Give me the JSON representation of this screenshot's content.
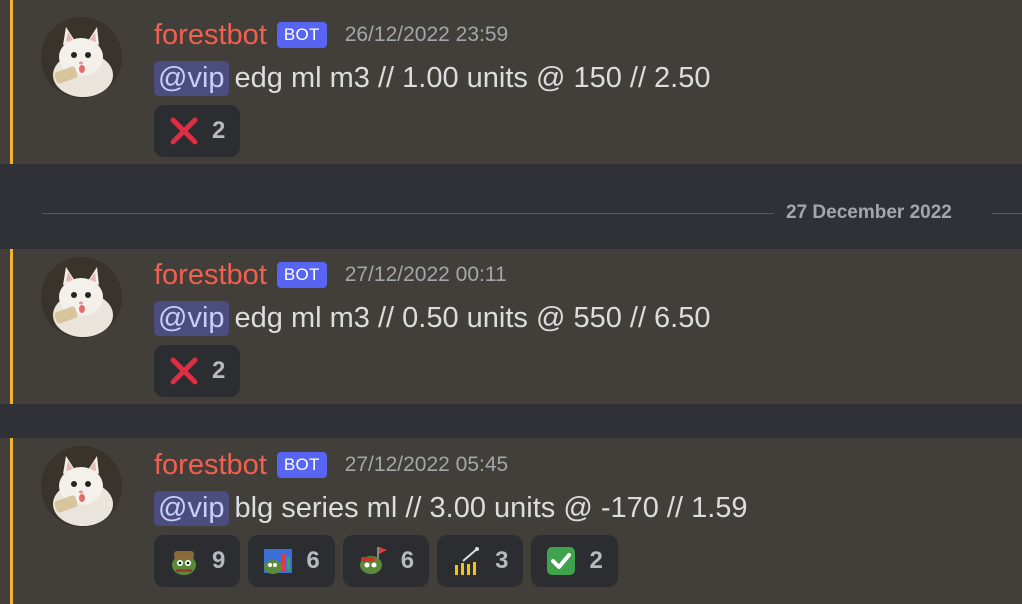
{
  "date_divider": "27 December 2022",
  "messages": [
    {
      "username": "forestbot",
      "bot_tag": "BOT",
      "timestamp": "26/12/2022 23:59",
      "mention": "@vip",
      "text": "edg ml m3 // 1.00 units @ 150 // 2.50",
      "reactions": [
        {
          "emoji": "cross-mark",
          "count": "2"
        }
      ]
    },
    {
      "username": "forestbot",
      "bot_tag": "BOT",
      "timestamp": "27/12/2022 00:11",
      "mention": "@vip",
      "text": "edg ml m3 // 0.50 units @ 550 // 6.50",
      "reactions": [
        {
          "emoji": "cross-mark",
          "count": "2"
        }
      ]
    },
    {
      "username": "forestbot",
      "bot_tag": "BOT",
      "timestamp": "27/12/2022 05:45",
      "mention": "@vip",
      "text": "blg series ml // 3.00 units @ -170 // 1.59",
      "reactions": [
        {
          "emoji": "pepe-miner",
          "count": "9"
        },
        {
          "emoji": "pepe-chart",
          "count": "6"
        },
        {
          "emoji": "pepe-flag",
          "count": "6"
        },
        {
          "emoji": "stonks-candles",
          "count": "3"
        },
        {
          "emoji": "check-mark",
          "count": "2"
        }
      ]
    }
  ],
  "colors": {
    "username": "#f0604f",
    "bot_tag": "#5865f2",
    "mention_bg": "#4a4d7e",
    "highlight_bar": "#f0b232",
    "message_bg": "#423f3a"
  }
}
